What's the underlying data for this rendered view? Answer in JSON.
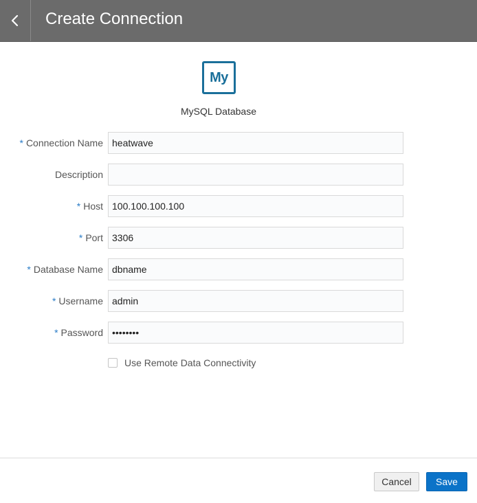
{
  "header": {
    "title": "Create Connection",
    "back_icon": "chevron-left-icon"
  },
  "connection_type": {
    "logo_text": "My",
    "name": "MySQL Database",
    "accent": "#1a6f9a"
  },
  "form": {
    "fields": [
      {
        "label": "Connection Name",
        "required": true,
        "value": "heatwave",
        "type": "text"
      },
      {
        "label": "Description",
        "required": false,
        "value": "",
        "type": "text"
      },
      {
        "label": "Host",
        "required": true,
        "value": "100.100.100.100",
        "type": "text"
      },
      {
        "label": "Port",
        "required": true,
        "value": "3306",
        "type": "text"
      },
      {
        "label": "Database Name",
        "required": true,
        "value": "dbname",
        "type": "text"
      },
      {
        "label": "Username",
        "required": true,
        "value": "admin",
        "type": "text"
      },
      {
        "label": "Password",
        "required": true,
        "value": "••••••••",
        "type": "password"
      }
    ],
    "required_marker": "*",
    "remote_checkbox": {
      "label": "Use Remote Data Connectivity",
      "checked": false
    }
  },
  "footer": {
    "cancel_label": "Cancel",
    "save_label": "Save",
    "save_color": "#0b73c8"
  }
}
